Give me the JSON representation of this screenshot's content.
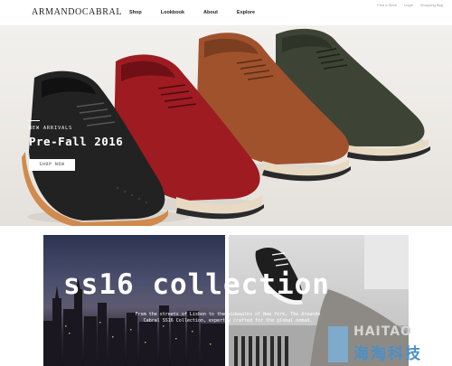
{
  "header": {
    "logo": "ARMANDOCABRAL",
    "nav": [
      "Shop",
      "Lookbook",
      "About",
      "Explore"
    ],
    "utility": [
      "Find a Store",
      "Login",
      "Shopping Bag"
    ]
  },
  "hero": {
    "kicker": "NEW ARRIVALS",
    "title": "Pre-Fall 2016",
    "button_label": "SHOP NOW"
  },
  "collection": {
    "title": "ss16 collection",
    "description": "From the streets of Lisbon to the sidewalks of New York, The Armando Cabral SS16 Collection, expertly crafted for the global nomad."
  },
  "watermark": {
    "en": "HAITAO",
    "cn": "海淘科技"
  },
  "colors": {
    "shoe_black": "#222222",
    "shoe_red": "#9e1b22",
    "shoe_tan": "#a0522d",
    "shoe_olive": "#3e4435",
    "sole": "#e8d9c2"
  }
}
